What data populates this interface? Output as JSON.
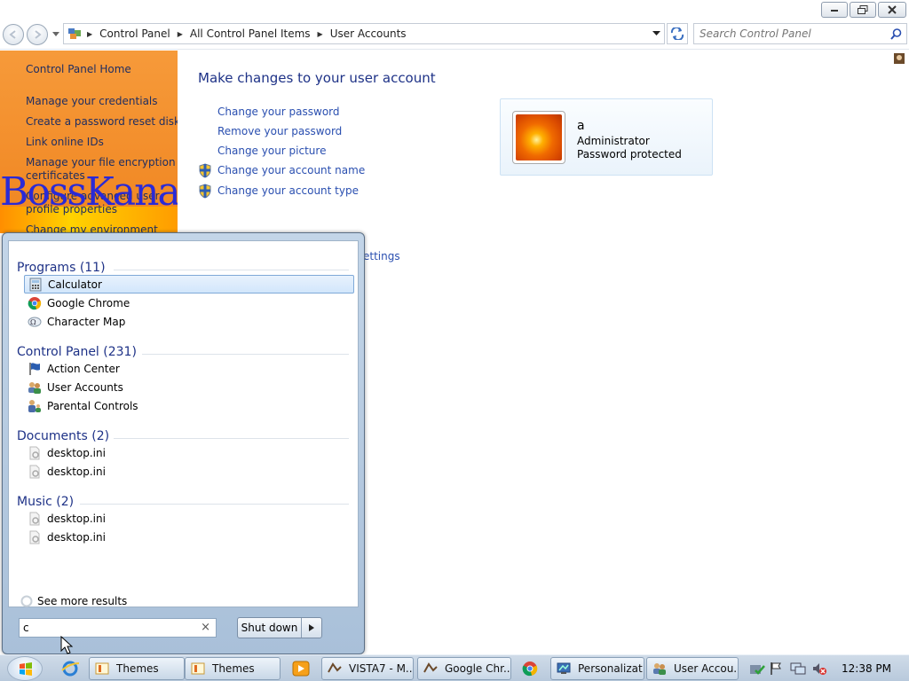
{
  "window": {
    "minimize_icon": "minimize-icon",
    "restore_icon": "restore-icon",
    "close_icon": "close-icon"
  },
  "navbar": {
    "breadcrumb": [
      "Control Panel",
      "All Control Panel Items",
      "User Accounts"
    ],
    "search_placeholder": "Search Control Panel"
  },
  "left_pane": {
    "items": [
      "Control Panel Home",
      "Manage your credentials",
      "Create a password reset disk",
      "Link online IDs",
      "Manage your file encryption",
      "certificates",
      "Configure advanced user",
      "profile properties",
      "Change my environment"
    ],
    "watermark": "BossKanae"
  },
  "main": {
    "heading": "Make changes to your user account",
    "tasks": [
      "Change your password",
      "Remove your password",
      "Change your picture",
      "Change your account name",
      "Change your account type"
    ],
    "partial_link": "ettings"
  },
  "user": {
    "name": "a",
    "role": "Administrator",
    "status": "Password protected"
  },
  "start_menu": {
    "groups": [
      {
        "title": "Programs (11)",
        "items": [
          "Calculator",
          "Google Chrome",
          "Character Map"
        ]
      },
      {
        "title": "Control Panel (231)",
        "items": [
          "Action Center",
          "User Accounts",
          "Parental Controls"
        ]
      },
      {
        "title": "Documents (2)",
        "items": [
          "desktop.ini",
          "desktop.ini"
        ]
      },
      {
        "title": "Music (2)",
        "items": [
          "desktop.ini",
          "desktop.ini"
        ]
      }
    ],
    "see_more": "See more results",
    "search_value": "c",
    "clear_glyph": "×",
    "shutdown_label": "Shut down"
  },
  "taskbar": {
    "buttons": [
      "Themes",
      "Themes",
      "VISTA7 - M...",
      "Google Chr...",
      "Personalizat...",
      "User Accou..."
    ],
    "clock": "12:38 PM"
  },
  "colors": {
    "accent_link": "#2a4fb0",
    "heading": "#1e3287",
    "left_pane": "#f08520"
  }
}
